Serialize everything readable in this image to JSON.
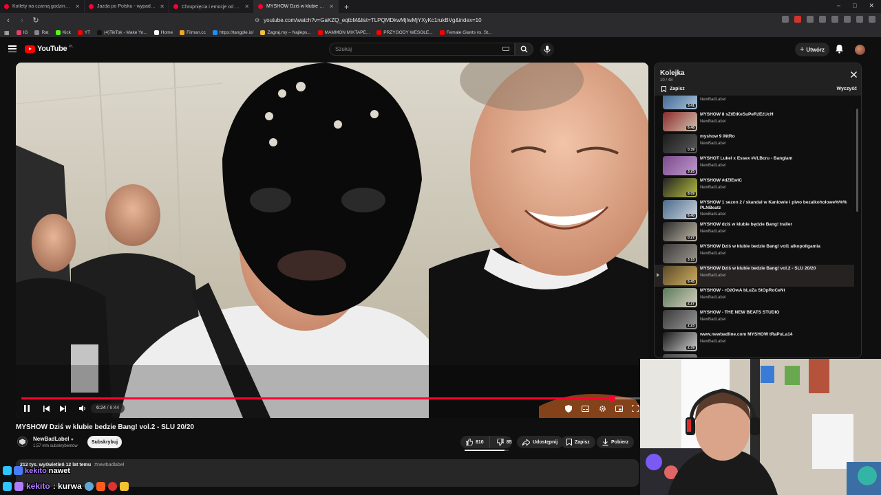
{
  "browser": {
    "tabs": [
      {
        "label": "Kotlety na czarną godzinę - mogą st",
        "active": false
      },
      {
        "label": "Jazda po Polsku - wypadki i kolizje d",
        "active": false
      },
      {
        "label": "Chrupnięcia i emocje od Poliny🤤 -",
        "active": false
      },
      {
        "label": "MYSHOW Dziś w klubie bedz",
        "active": true
      }
    ],
    "url": "youtube.com/watch?v=GaKZQ_eqtbM&list=TLPQMDkwMjIwMjYXyKc1rukBVg&index=10",
    "bookmarks": [
      "IG",
      "Rat",
      "Kick",
      "YT",
      "(4)TikTok - Make Yo...",
      "Home",
      "Filman.cc",
      "https://tangple.io/",
      "Zagraj.my – Najleps...",
      "MAMMON MIXTAPE...",
      "PRZYGODY WESOŁE...",
      "Female Giants vs. St..."
    ],
    "bookmark_colors": [
      "#e4405f",
      "#888888",
      "#53fc18",
      "#ff0000",
      "#111111",
      "#ffffff",
      "#f5a623",
      "#1e90ff",
      "#f0c040",
      "#ff0000",
      "#ff0000",
      "#ff0000"
    ]
  },
  "youtube": {
    "logo_text": "YouTube",
    "logo_country": "PL",
    "search_placeholder": "Szukaj",
    "create_label": "Utwórz"
  },
  "player": {
    "time_current": "6:24",
    "time_separator": " / ",
    "time_duration": "6:44",
    "progress_fraction": 0.9504,
    "accent_color": "#ff0033"
  },
  "video": {
    "title": "MYSHOW Dziś w klubie bedzie Bang! vol.2 - SLU 20/20",
    "channel": "NewBadLabel",
    "subscribers": "1,57 mln subskrybentów",
    "subscribe_label": "Subskrybuj",
    "likes": "810",
    "dislikes": "85",
    "share_label": "Udostępnij",
    "save_label": "Zapisz",
    "download_label": "Pobierz",
    "like_ratio": 0.905,
    "stats": "212 tys. wyświetleń  12 lat temu",
    "hashtag": "#newbadlabel"
  },
  "playlist": {
    "title": "Kolejka",
    "position": "10 / 48",
    "save_label": "Zapisz",
    "clear_label": "Wyczyść",
    "items": [
      {
        "title": "",
        "channel": "NewBadLabel",
        "duration": "3:41",
        "active": false,
        "thumb": [
          "#3a5f8a",
          "#a8c4dd"
        ]
      },
      {
        "title": "MYSHOW 8 sZtEtKeSuPeRżEżUcH",
        "channel": "NewBadLabel",
        "duration": "6:48",
        "active": false,
        "thumb": [
          "#8a2b2b",
          "#d4c4b0"
        ]
      },
      {
        "title": "myshow 9 iNtRo",
        "channel": "NewBadLabel",
        "duration": "0:39",
        "active": false,
        "thumb": [
          "#1a1a1a",
          "#5a5a5a"
        ]
      },
      {
        "title": "MYSHOT Lukel x Essex #VLBcru - Banglam",
        "channel": "NewBadLabel",
        "duration": "3:25",
        "active": false,
        "thumb": [
          "#7a4a8a",
          "#c09ad0"
        ]
      },
      {
        "title": "MYSHOW #dZIEwIĆ",
        "channel": "NewBadLabel",
        "duration": "8:09",
        "active": false,
        "thumb": [
          "#222222",
          "#b8c040"
        ]
      },
      {
        "title": "MYSHOW 1 sezon 2 / skandal w Kaniowie i piwo bezalkoholowe%%% PLNBeatz",
        "channel": "NewBadLabel",
        "duration": "6:40",
        "active": false,
        "thumb": [
          "#4a6a8a",
          "#d0d8e0"
        ]
      },
      {
        "title": "MYSHOW dziś w klubie będzie Bang! trailer",
        "channel": "NewBadLabel",
        "duration": "0:27",
        "active": false,
        "thumb": [
          "#2a2a2a",
          "#c0b8a8"
        ]
      },
      {
        "title": "MYSHOW Dziś w klubie bedzie Bang! vol1 alkopoligamia",
        "channel": "NewBadLabel",
        "duration": "3:15",
        "active": false,
        "thumb": [
          "#3a3a3a",
          "#a09890"
        ]
      },
      {
        "title": "MYSHOW Dziś w klubie bedzie Bang! vol.2 - SLU 20/20",
        "channel": "NewBadLabel",
        "duration": "6:45",
        "active": true,
        "thumb": [
          "#5a4a2a",
          "#d0b060"
        ]
      },
      {
        "title": "MYSHOW - rÓżOwA bLuZa StOpRoCeNt",
        "channel": "NewBadLabel",
        "duration": "2:27",
        "active": false,
        "thumb": [
          "#5a7a5a",
          "#d8d0c0"
        ]
      },
      {
        "title": "MYSHOW - THE NEW BEATS STUDIO",
        "channel": "NewBadLabel",
        "duration": "2:23",
        "active": false,
        "thumb": [
          "#3a3a3a",
          "#9a9a9a"
        ]
      },
      {
        "title": "www.newbadline.com MYSHOW tRaPuLa14",
        "channel": "NewBadLabel",
        "duration": "2:39",
        "active": false,
        "thumb": [
          "#1a1a1a",
          "#cfcfcf"
        ]
      },
      {
        "title": "",
        "channel": "",
        "duration": "",
        "active": false,
        "thumb": [
          "#4a4a4a",
          "#8a8a8a"
        ]
      }
    ]
  },
  "overlay": {
    "chat_line_1_user": "kekito",
    "chat_line_1_text": "nawet",
    "chat_line_2_user": "kekito",
    "chat_line_2_text": ": kurwa"
  }
}
